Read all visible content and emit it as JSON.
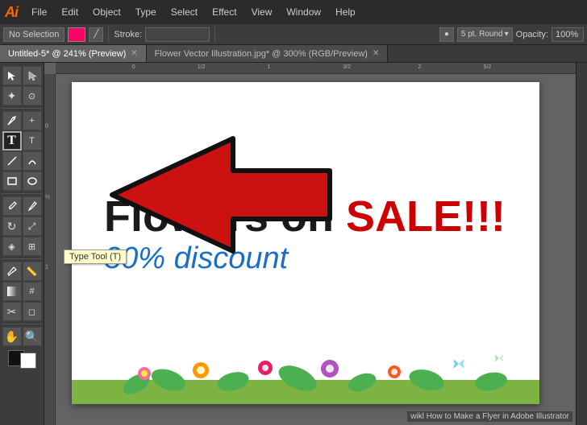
{
  "app": {
    "logo": "Ai",
    "title": "Adobe Illustrator"
  },
  "menu": {
    "items": [
      "File",
      "Edit",
      "Object",
      "Type",
      "Select",
      "Effect",
      "View",
      "Window",
      "Help"
    ]
  },
  "toolbar": {
    "no_selection_label": "No Selection",
    "stroke_label": "Stroke:",
    "weight_label": "5 pt. Round",
    "opacity_label": "Opacity:",
    "opacity_value": "100%"
  },
  "tabs": [
    {
      "label": "Untitled-5* @ 241% (Preview)",
      "active": true
    },
    {
      "label": "Flower Vector Illustration.jpg* @ 300% (RGB/Preview)",
      "active": false
    }
  ],
  "tools": [
    {
      "name": "selection",
      "icon": "↖",
      "active": false
    },
    {
      "name": "direct-selection",
      "icon": "↗",
      "active": false
    },
    {
      "name": "magic-wand",
      "icon": "✦",
      "active": false
    },
    {
      "name": "lasso",
      "icon": "⊙",
      "active": false
    },
    {
      "name": "pen",
      "icon": "✒",
      "active": false
    },
    {
      "name": "type",
      "icon": "T",
      "active": true
    },
    {
      "name": "line",
      "icon": "\\",
      "active": false
    },
    {
      "name": "shape",
      "icon": "□",
      "active": false
    },
    {
      "name": "paintbrush",
      "icon": "✏",
      "active": false
    },
    {
      "name": "pencil",
      "icon": "✎",
      "active": false
    },
    {
      "name": "rotate",
      "icon": "↻",
      "active": false
    },
    {
      "name": "scale",
      "icon": "⤢",
      "active": false
    },
    {
      "name": "blend",
      "icon": "◈",
      "active": false
    },
    {
      "name": "eyedropper",
      "icon": "⊘",
      "active": false
    },
    {
      "name": "gradient",
      "icon": "▦",
      "active": false
    },
    {
      "name": "mesh",
      "icon": "#",
      "active": false
    },
    {
      "name": "scissors",
      "icon": "✂",
      "active": false
    },
    {
      "name": "hand",
      "icon": "✋",
      "active": false
    },
    {
      "name": "zoom",
      "icon": "⊕",
      "active": false
    }
  ],
  "tooltip": {
    "text": "Type Tool (T)"
  },
  "flyer": {
    "line1_part1": "Flowers on ",
    "line1_part2": "SALE!!!",
    "line2": "30% discount"
  },
  "rulers": {
    "h_labels": [
      "0",
      "1/2",
      "1",
      "3/2",
      "2",
      "5/2"
    ],
    "v_labels": [
      "0",
      "1/2",
      "1"
    ]
  },
  "watermark": {
    "text": "wikl How to Make a Flyer in Adobe Illustrator"
  },
  "colors": {
    "accent_red": "#cc0000",
    "accent_blue": "#1a6ec7",
    "arrow_red": "#cc1111",
    "toolbar_bg": "#3c3c3c",
    "canvas_bg": "#636363"
  }
}
